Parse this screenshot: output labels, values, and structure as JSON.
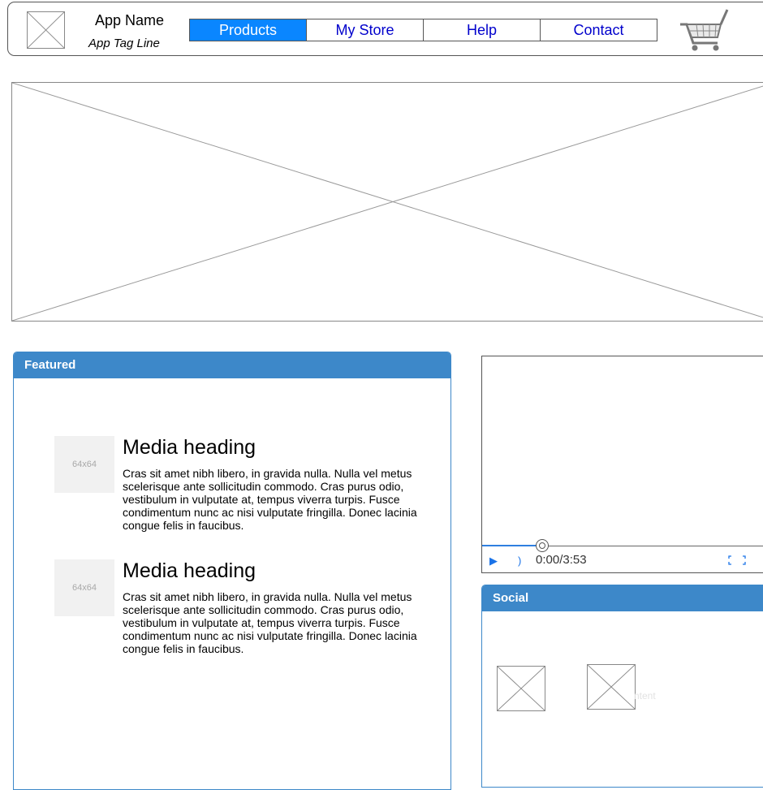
{
  "header": {
    "app_name": "App Name",
    "app_tagline": "App Tag Line",
    "nav": [
      "Products",
      "My Store",
      "Help",
      "Contact"
    ],
    "active_nav": "Products"
  },
  "featured": {
    "title": "Featured",
    "items": [
      {
        "thumb": "64x64",
        "heading": "Media heading",
        "body": "Cras sit amet nibh libero, in gravida nulla. Nulla vel metus scelerisque ante sollicitudin commodo. Cras purus odio, vestibulum in vulputate at, tempus viverra turpis. Fusce condimentum nunc ac nisi vulputate fringilla. Donec lacinia congue felis in faucibus."
      },
      {
        "thumb": "64x64",
        "heading": "Media heading",
        "body": "Cras sit amet nibh libero, in gravida nulla. Nulla vel metus scelerisque ante sollicitudin commodo. Cras purus odio, vestibulum in vulputate at, tempus viverra turpis. Fusce condimentum nunc ac nisi vulputate fringilla. Donec lacinia congue felis in faucibus."
      }
    ]
  },
  "video": {
    "time": "0:00/3:53",
    "progress_fraction": 0.0
  },
  "social": {
    "title": "Social",
    "faint_text": "ntent"
  },
  "colors": {
    "accent": "#3d88c9",
    "nav_active": "#0a86ff",
    "link": "#0000cc"
  },
  "icons": [
    "image-placeholder-icon",
    "cart-icon",
    "play-icon",
    "volume-icon",
    "fullscreen-icon"
  ]
}
